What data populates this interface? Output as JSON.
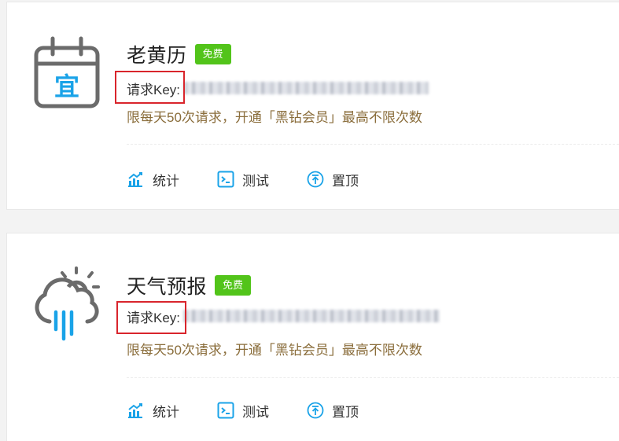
{
  "apis": [
    {
      "title": "老黄历",
      "badge": "免费",
      "key_label": "请求Key:",
      "key_value": "",
      "limit_note": "限每天50次请求，开通「黑钻会员」最高不限次数",
      "actions": {
        "stats": "统计",
        "test": "测试",
        "pin": "置顶"
      },
      "icon": "almanac-calendar-icon",
      "icon_char": "宜"
    },
    {
      "title": "天气预报",
      "badge": "免费",
      "key_label": "请求Key:",
      "key_value": "",
      "limit_note": "限每天50次请求，开通「黑钻会员」最高不限次数",
      "actions": {
        "stats": "统计",
        "test": "测试",
        "pin": "置顶"
      },
      "icon": "weather-cloud-sun-rain-icon"
    }
  ],
  "colors": {
    "badge_green": "#52c41a",
    "accent_blue": "#1aa3e8",
    "icon_gray": "#666666",
    "note_brown": "#8a6d3b",
    "highlight_red": "#d9252c"
  }
}
